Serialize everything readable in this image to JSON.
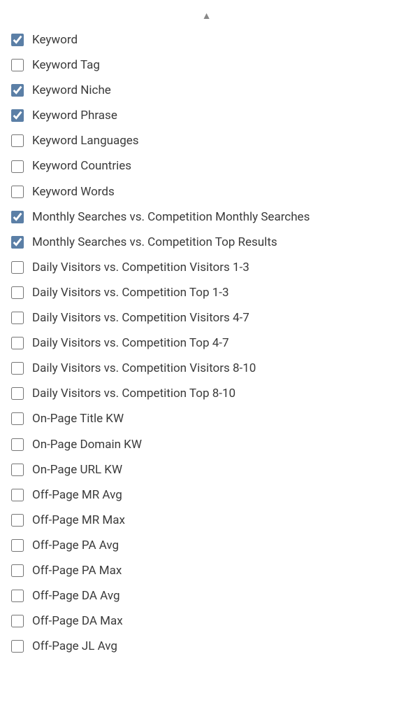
{
  "items": [
    {
      "id": "keyword",
      "label": "Keyword",
      "checked": true
    },
    {
      "id": "keyword-tag",
      "label": "Keyword Tag",
      "checked": false
    },
    {
      "id": "keyword-niche",
      "label": "Keyword Niche",
      "checked": true
    },
    {
      "id": "keyword-phrase",
      "label": "Keyword Phrase",
      "checked": true
    },
    {
      "id": "keyword-languages",
      "label": "Keyword Languages",
      "checked": false
    },
    {
      "id": "keyword-countries",
      "label": "Keyword Countries",
      "checked": false
    },
    {
      "id": "keyword-words",
      "label": "Keyword Words",
      "checked": false
    },
    {
      "id": "monthly-searches-competition-monthly",
      "label": "Monthly Searches vs. Competition Monthly Searches",
      "checked": true
    },
    {
      "id": "monthly-searches-competition-top",
      "label": "Monthly Searches vs. Competition Top Results",
      "checked": true
    },
    {
      "id": "daily-visitors-competition-visitors-1-3",
      "label": "Daily Visitors vs. Competition Visitors 1-3",
      "checked": false
    },
    {
      "id": "daily-visitors-competition-top-1-3",
      "label": "Daily Visitors vs. Competition Top 1-3",
      "checked": false
    },
    {
      "id": "daily-visitors-competition-visitors-4-7",
      "label": "Daily Visitors vs. Competition Visitors 4-7",
      "checked": false
    },
    {
      "id": "daily-visitors-competition-top-4-7",
      "label": "Daily Visitors vs. Competition Top 4-7",
      "checked": false
    },
    {
      "id": "daily-visitors-competition-visitors-8-10",
      "label": "Daily Visitors vs. Competition Visitors 8-10",
      "checked": false
    },
    {
      "id": "daily-visitors-competition-top-8-10",
      "label": "Daily Visitors vs. Competition Top 8-10",
      "checked": false
    },
    {
      "id": "on-page-title-kw",
      "label": "On-Page Title KW",
      "checked": false
    },
    {
      "id": "on-page-domain-kw",
      "label": "On-Page Domain KW",
      "checked": false
    },
    {
      "id": "on-page-url-kw",
      "label": "On-Page URL KW",
      "checked": false
    },
    {
      "id": "off-page-mr-avg",
      "label": "Off-Page MR Avg",
      "checked": false
    },
    {
      "id": "off-page-mr-max",
      "label": "Off-Page MR Max",
      "checked": false
    },
    {
      "id": "off-page-pa-avg",
      "label": "Off-Page PA Avg",
      "checked": false
    },
    {
      "id": "off-page-pa-max",
      "label": "Off-Page PA Max",
      "checked": false
    },
    {
      "id": "off-page-da-avg",
      "label": "Off-Page DA Avg",
      "checked": false
    },
    {
      "id": "off-page-da-max",
      "label": "Off-Page DA Max",
      "checked": false
    },
    {
      "id": "off-page-jl-avg",
      "label": "Off-Page JL Avg",
      "checked": false
    }
  ]
}
